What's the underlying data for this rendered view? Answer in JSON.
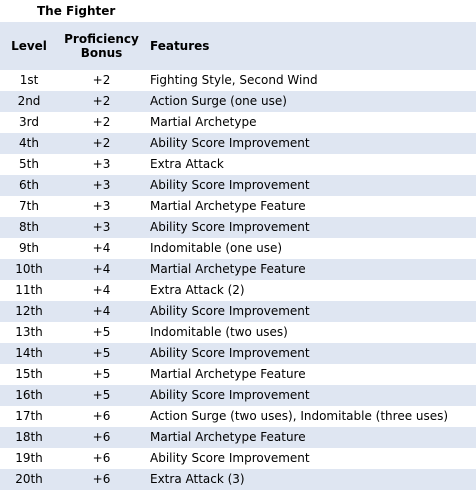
{
  "title": "The Fighter",
  "columns": {
    "level": "Level",
    "proficiency_line1": "Proficiency",
    "proficiency_line2": "Bonus",
    "features": "Features"
  },
  "rows": [
    {
      "level": "1st",
      "prof": "+2",
      "features": "Fighting Style, Second Wind"
    },
    {
      "level": "2nd",
      "prof": "+2",
      "features": "Action Surge (one use)"
    },
    {
      "level": "3rd",
      "prof": "+2",
      "features": "Martial Archetype"
    },
    {
      "level": "4th",
      "prof": "+2",
      "features": "Ability Score Improvement"
    },
    {
      "level": "5th",
      "prof": "+3",
      "features": "Extra Attack"
    },
    {
      "level": "6th",
      "prof": "+3",
      "features": "Ability Score Improvement"
    },
    {
      "level": "7th",
      "prof": "+3",
      "features": "Martial Archetype Feature"
    },
    {
      "level": "8th",
      "prof": "+3",
      "features": "Ability Score Improvement"
    },
    {
      "level": "9th",
      "prof": "+4",
      "features": "Indomitable (one use)"
    },
    {
      "level": "10th",
      "prof": "+4",
      "features": "Martial Archetype Feature"
    },
    {
      "level": "11th",
      "prof": "+4",
      "features": "Extra Attack (2)"
    },
    {
      "level": "12th",
      "prof": "+4",
      "features": "Ability Score Improvement"
    },
    {
      "level": "13th",
      "prof": "+5",
      "features": "Indomitable (two uses)"
    },
    {
      "level": "14th",
      "prof": "+5",
      "features": "Ability Score Improvement"
    },
    {
      "level": "15th",
      "prof": "+5",
      "features": "Martial Archetype Feature"
    },
    {
      "level": "16th",
      "prof": "+5",
      "features": "Ability Score Improvement"
    },
    {
      "level": "17th",
      "prof": "+6",
      "features": "Action Surge (two uses), Indomitable (three uses)"
    },
    {
      "level": "18th",
      "prof": "+6",
      "features": "Martial Archetype Feature"
    },
    {
      "level": "19th",
      "prof": "+6",
      "features": "Ability Score Improvement"
    },
    {
      "level": "20th",
      "prof": "+6",
      "features": "Extra Attack (3)"
    }
  ],
  "colors": {
    "stripe": "#dfe6f2",
    "background": "#ffffff",
    "text": "#000000"
  }
}
